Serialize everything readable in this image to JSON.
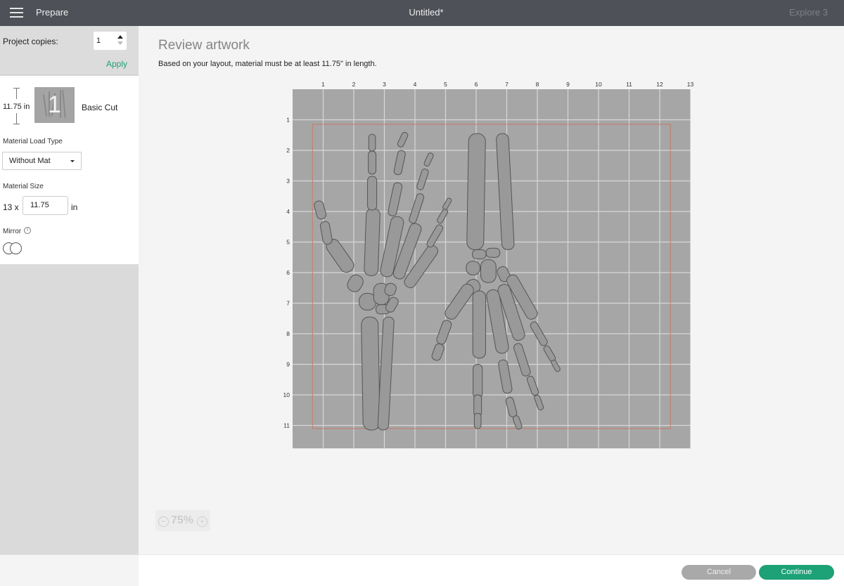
{
  "topbar": {
    "menu_icon": "hamburger-menu-icon",
    "section": "Prepare",
    "title": "Untitled*",
    "machine": "Explore 3"
  },
  "sidebar": {
    "copies_label": "Project copies:",
    "copies_value": "1",
    "apply_label": "Apply",
    "mat": {
      "length_label": "11.75 in",
      "thumbnail_number": "1",
      "name": "Basic Cut"
    },
    "load_type_label": "Material Load Type",
    "load_type_value": "Without Mat",
    "size_label": "Material Size",
    "size_width": "13 x",
    "size_length": "11.75",
    "size_unit": "in",
    "mirror_label": "Mirror",
    "mirror_info_icon": "info-icon",
    "mirror_on": false
  },
  "main": {
    "title": "Review artwork",
    "subtitle": "Based on your layout, material must be at least 11.75\" in length.",
    "mat_grid": {
      "x_ticks": [
        "1",
        "2",
        "3",
        "4",
        "5",
        "6",
        "7",
        "8",
        "9",
        "10",
        "11",
        "12",
        "13"
      ],
      "y_ticks": [
        "1",
        "2",
        "3",
        "4",
        "5",
        "6",
        "7",
        "8",
        "9",
        "10",
        "11"
      ],
      "width_in": 13,
      "height_in": 11.75,
      "bounds_in": {
        "x0": 0.65,
        "y0": 1.15,
        "x1": 12.35,
        "y1": 11.1
      },
      "artwork": "skeleton hand bones (two hands)"
    },
    "zoom_level": "75%"
  },
  "footer": {
    "cancel_label": "Cancel",
    "continue_label": "Continue"
  },
  "colors": {
    "accent": "#1da176",
    "topbar": "#4e5157",
    "mat": "#a6a6a6",
    "bounds": "#c77a6a"
  }
}
